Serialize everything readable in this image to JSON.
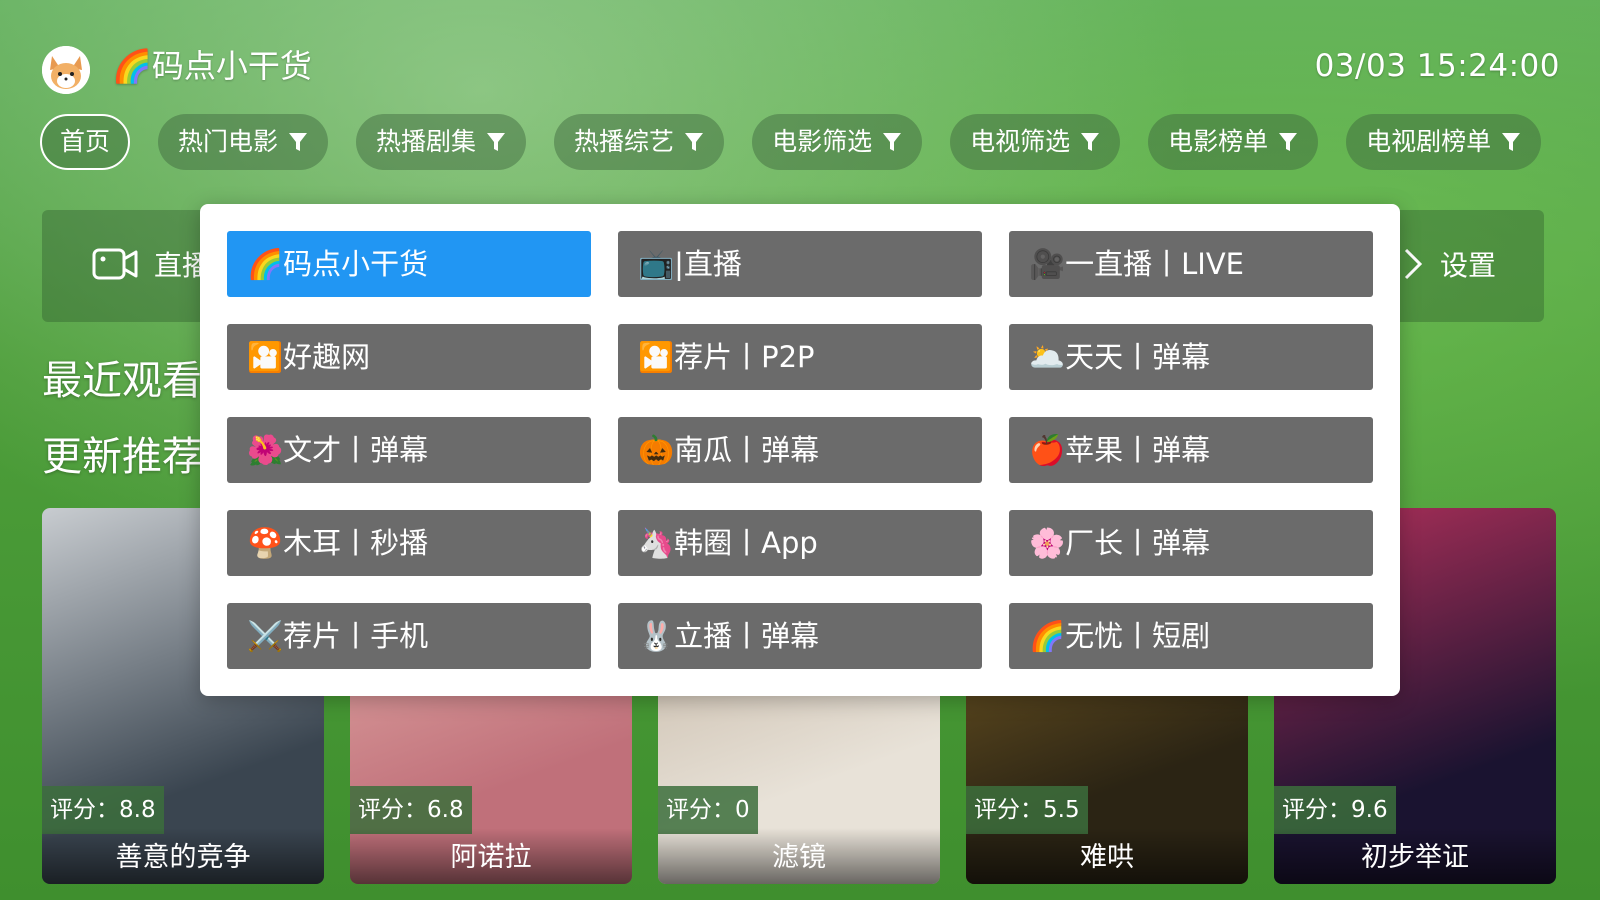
{
  "header": {
    "app_title": "🌈码点小干货",
    "clock": "03/03 15:24:00"
  },
  "nav": {
    "tabs": [
      {
        "label": "首页",
        "filter": false
      },
      {
        "label": "热门电影",
        "filter": true
      },
      {
        "label": "热播剧集",
        "filter": true
      },
      {
        "label": "热播综艺",
        "filter": true
      },
      {
        "label": "电影筛选",
        "filter": true
      },
      {
        "label": "电视筛选",
        "filter": true
      },
      {
        "label": "电影榜单",
        "filter": true
      },
      {
        "label": "电视剧榜单",
        "filter": true
      }
    ]
  },
  "shortcuts": {
    "live_label": "直播",
    "settings_label": "设置"
  },
  "sections": {
    "recent": "最近观看",
    "recommend": "更新推荐"
  },
  "posters": [
    {
      "rating": "评分：8.8",
      "title": "善意的竞争",
      "color_a": "#3a4550",
      "color_b": "#c8ccd0"
    },
    {
      "rating": "评分：6.8",
      "title": "阿诺拉",
      "color_a": "#c0707a",
      "color_b": "#e9b8b0"
    },
    {
      "rating": "评分：0",
      "title": "滤镜",
      "color_a": "#e8e2d8",
      "color_b": "#b9a894"
    },
    {
      "rating": "评分：5.5",
      "title": "难哄",
      "color_a": "#2b2414",
      "color_b": "#8a6a28"
    },
    {
      "rating": "评分：9.6",
      "title": "初步举证",
      "color_a": "#1a1330",
      "color_b": "#b0305a"
    }
  ],
  "sources": [
    {
      "label": "🌈码点小干货",
      "active": true
    },
    {
      "label": "📺|直播",
      "active": false
    },
    {
      "label": "🎥一直播丨LIVE",
      "active": false
    },
    {
      "label": "🎦好趣网",
      "active": false
    },
    {
      "label": "🎦荐片丨P2P",
      "active": false
    },
    {
      "label": "🌥️天天丨弹幕",
      "active": false
    },
    {
      "label": "🌺文才丨弹幕",
      "active": false
    },
    {
      "label": "🎃南瓜丨弹幕",
      "active": false
    },
    {
      "label": "🍎苹果丨弹幕",
      "active": false
    },
    {
      "label": "🍄木耳丨秒播",
      "active": false
    },
    {
      "label": "🦄韩圈丨App",
      "active": false
    },
    {
      "label": "🌸厂长丨弹幕",
      "active": false
    },
    {
      "label": "⚔️荐片丨手机",
      "active": false
    },
    {
      "label": "🐰立播丨弹幕",
      "active": false
    },
    {
      "label": "🌈无忧丨短剧",
      "active": false
    }
  ],
  "colors": {
    "active_source": "#2196f3",
    "source_bg": "#6b6b6b"
  }
}
